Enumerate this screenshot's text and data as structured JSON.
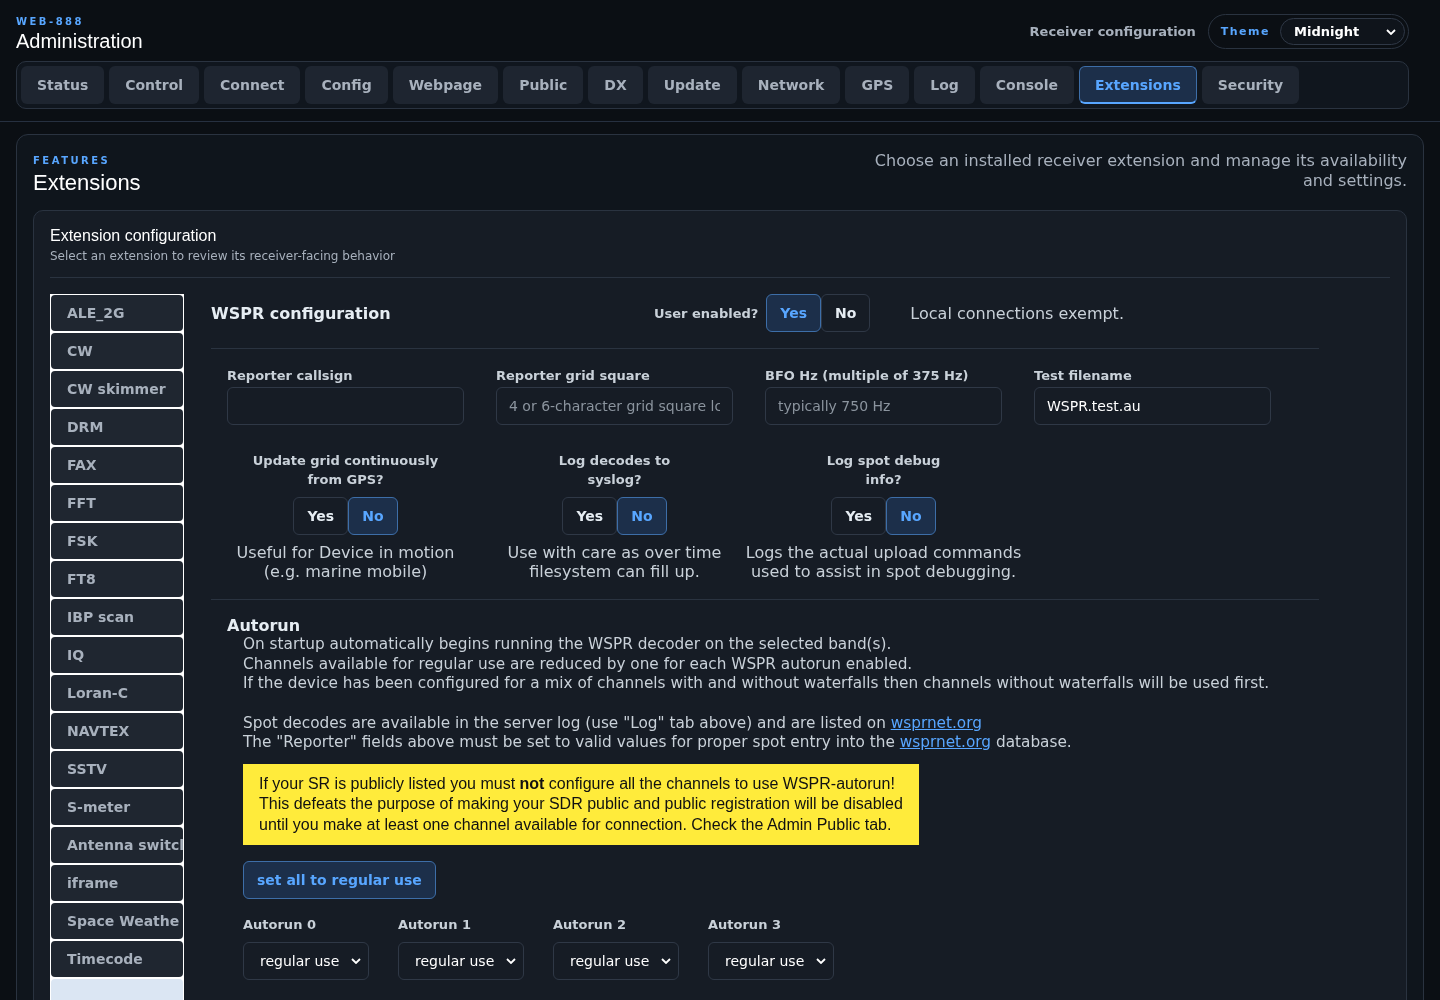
{
  "header": {
    "brand": "WEB-888",
    "title": "Administration",
    "receiver_label": "Receiver configuration",
    "theme": {
      "label": "Theme",
      "value": "Midnight"
    }
  },
  "tabs": [
    {
      "label": "Status",
      "selected": false
    },
    {
      "label": "Control",
      "selected": false
    },
    {
      "label": "Connect",
      "selected": false
    },
    {
      "label": "Config",
      "selected": false
    },
    {
      "label": "Webpage",
      "selected": false
    },
    {
      "label": "Public",
      "selected": false
    },
    {
      "label": "DX",
      "selected": false
    },
    {
      "label": "Update",
      "selected": false
    },
    {
      "label": "Network",
      "selected": false
    },
    {
      "label": "GPS",
      "selected": false
    },
    {
      "label": "Log",
      "selected": false
    },
    {
      "label": "Console",
      "selected": false
    },
    {
      "label": "Extensions",
      "selected": true
    },
    {
      "label": "Security",
      "selected": false
    }
  ],
  "section": {
    "eyebrow": "FEATURES",
    "title": "Extensions",
    "description": "Choose an installed receiver extension and manage its availability and settings."
  },
  "panel": {
    "title": "Extension configuration",
    "subtitle": "Select an extension to review its receiver-facing behavior"
  },
  "extensions": [
    {
      "label": "ALE_2G",
      "selected": false
    },
    {
      "label": "CW",
      "selected": false
    },
    {
      "label": "CW skimmer",
      "selected": false
    },
    {
      "label": "DRM",
      "selected": false
    },
    {
      "label": "FAX",
      "selected": false
    },
    {
      "label": "FFT",
      "selected": false
    },
    {
      "label": "FSK",
      "selected": false
    },
    {
      "label": "FT8",
      "selected": false
    },
    {
      "label": "IBP scan",
      "selected": false
    },
    {
      "label": "IQ",
      "selected": false
    },
    {
      "label": "Loran-C",
      "selected": false
    },
    {
      "label": "NAVTEX",
      "selected": false
    },
    {
      "label": "SSTV",
      "selected": false
    },
    {
      "label": "S-meter",
      "selected": false
    },
    {
      "label": "Antenna switcl",
      "selected": false
    },
    {
      "label": "iframe",
      "selected": false
    },
    {
      "label": "Space Weathe",
      "selected": false
    },
    {
      "label": "Timecode",
      "selected": false
    },
    {
      "selected": true
    }
  ],
  "config": {
    "title": "WSPR configuration",
    "user_enabled": {
      "label": "User enabled?",
      "options": [
        {
          "label": "Yes",
          "selected": true
        },
        {
          "label": "No",
          "selected": false
        }
      ],
      "note": "Local connections exempt."
    },
    "fields": [
      {
        "label": "Reporter callsign"
      },
      {
        "label": "Reporter grid square",
        "placeholder": "4 or 6-character grid square lc"
      },
      {
        "label": "BFO Hz (multiple of 375 Hz)",
        "placeholder": "typically 750 Hz"
      },
      {
        "label": "Test filename",
        "value": "WSPR.test.au"
      }
    ],
    "toggles": [
      {
        "label_lines": [
          "Update grid continuously",
          "from GPS?"
        ],
        "options": [
          {
            "label": "Yes",
            "selected": false
          },
          {
            "label": "No",
            "selected": true
          }
        ],
        "note_lines": [
          "Useful for Device in motion",
          "(e.g. marine mobile)"
        ]
      },
      {
        "label_lines": [
          "Log decodes to",
          "syslog?"
        ],
        "options": [
          {
            "label": "Yes",
            "selected": false
          },
          {
            "label": "No",
            "selected": true
          }
        ],
        "note_lines": [
          "Use with care as over time",
          "filesystem can fill up."
        ]
      },
      {
        "label_lines": [
          "Log spot debug",
          "info?"
        ],
        "options": [
          {
            "label": "Yes",
            "selected": false
          },
          {
            "label": "No",
            "selected": true
          }
        ],
        "note_lines": [
          "Logs the actual upload commands",
          "used to assist in spot debugging."
        ]
      }
    ]
  },
  "autorun": {
    "title": "Autorun",
    "lines": [
      "On startup automatically begins running the WSPR decoder on the selected band(s).",
      "Channels available for regular use are reduced by one for each WSPR autorun enabled.",
      "If the device has been configured for a mix of channels with and without waterfalls then channels without waterfalls will be used first."
    ],
    "link_lines": [
      {
        "text": "Spot decodes are available in the server log (use \"Log\" tab above) and are listed on ",
        "link": "wsprnet.org"
      },
      {
        "text": "The \"Reporter\" fields above must be set to valid values for proper spot entry into the ",
        "link": "wsprnet.org",
        "after": " database."
      }
    ],
    "warning_lines": [
      "If your SR is publicly listed you must **not** configure all the channels to use WSPR-autorun!",
      "This defeats the purpose of making your SDR public and public registration will be disabled",
      "until you make at least one channel available for connection. Check the Admin Public tab."
    ],
    "button": "set all to regular use",
    "selects": [
      {
        "label": "Autorun 0",
        "value": "regular use"
      },
      {
        "label": "Autorun 1",
        "value": "regular use"
      },
      {
        "label": "Autorun 2",
        "value": "regular use"
      },
      {
        "label": "Autorun 3",
        "value": "regular use"
      }
    ]
  }
}
